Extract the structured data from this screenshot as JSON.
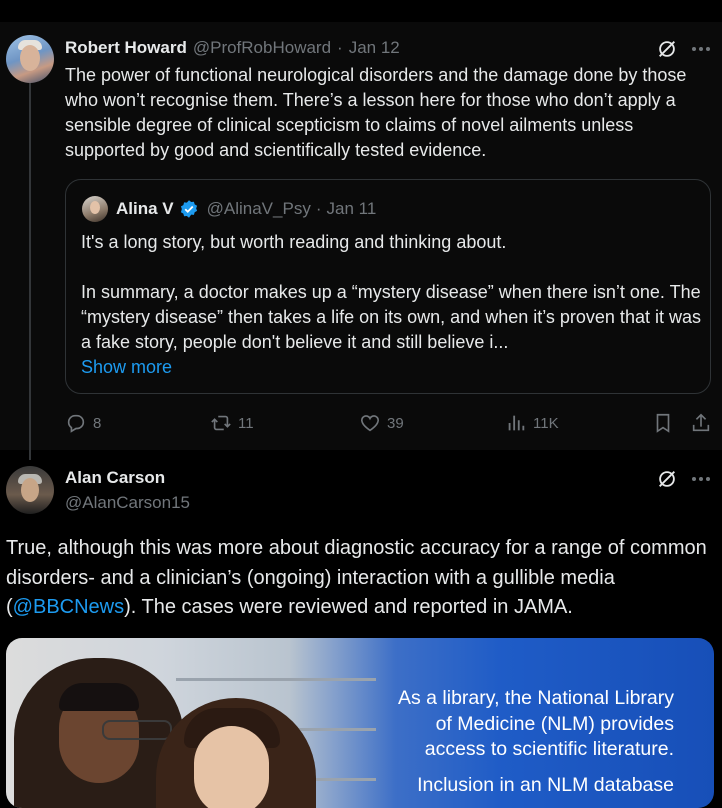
{
  "tweet1": {
    "author_name": "Robert Howard",
    "author_handle": "@ProfRobHoward",
    "separator": "·",
    "date": "Jan 12",
    "text": "The power of functional neurological disorders and the damage done by those who won’t recognise them. There’s a lesson here for those who don’t apply a sensible degree of clinical scepticism to claims of novel ailments unless supported by good and scientifically tested evidence.",
    "quote": {
      "author_name": "Alina V",
      "author_handle": "@AlinaV_Psy",
      "separator": "·",
      "date": "Jan 11",
      "line1": "It's a long story, but worth reading and thinking about.",
      "line2": "In summary, a doctor makes up a “mystery disease” when there isn’t one. The “mystery disease” then takes a life on its own, and when it’s proven that it was a fake story, people don't believe it and still believe i...",
      "show_more": "Show more"
    },
    "actions": {
      "replies": "8",
      "reposts": "11",
      "likes": "39",
      "views": "11K"
    }
  },
  "tweet2": {
    "author_name": "Alan Carson",
    "author_handle": "@AlanCarson15",
    "text_before_link": "True, although this was more about diagnostic accuracy for a range of common disorders- and a clinician’s (ongoing) interaction with a gullible media (",
    "link": "@BBCNews",
    "text_after_link": "). The cases were reviewed and reported in JAMA.",
    "media": {
      "line1": "As a library, the National Library",
      "line2": "of Medicine (NLM) provides",
      "line3": "access to scientific literature.",
      "line4": "Inclusion in an NLM database"
    }
  },
  "colors": {
    "background": "#000000",
    "post_background": "#0a0a0a",
    "text": "#e7e9ea",
    "muted": "#71767b",
    "link": "#1d9bf0",
    "verified": "#1d9bf0"
  },
  "icons": [
    "grok-icon",
    "more-icon",
    "verified-badge-icon",
    "reply-icon",
    "repost-icon",
    "like-icon",
    "views-icon",
    "bookmark-icon",
    "share-icon"
  ]
}
